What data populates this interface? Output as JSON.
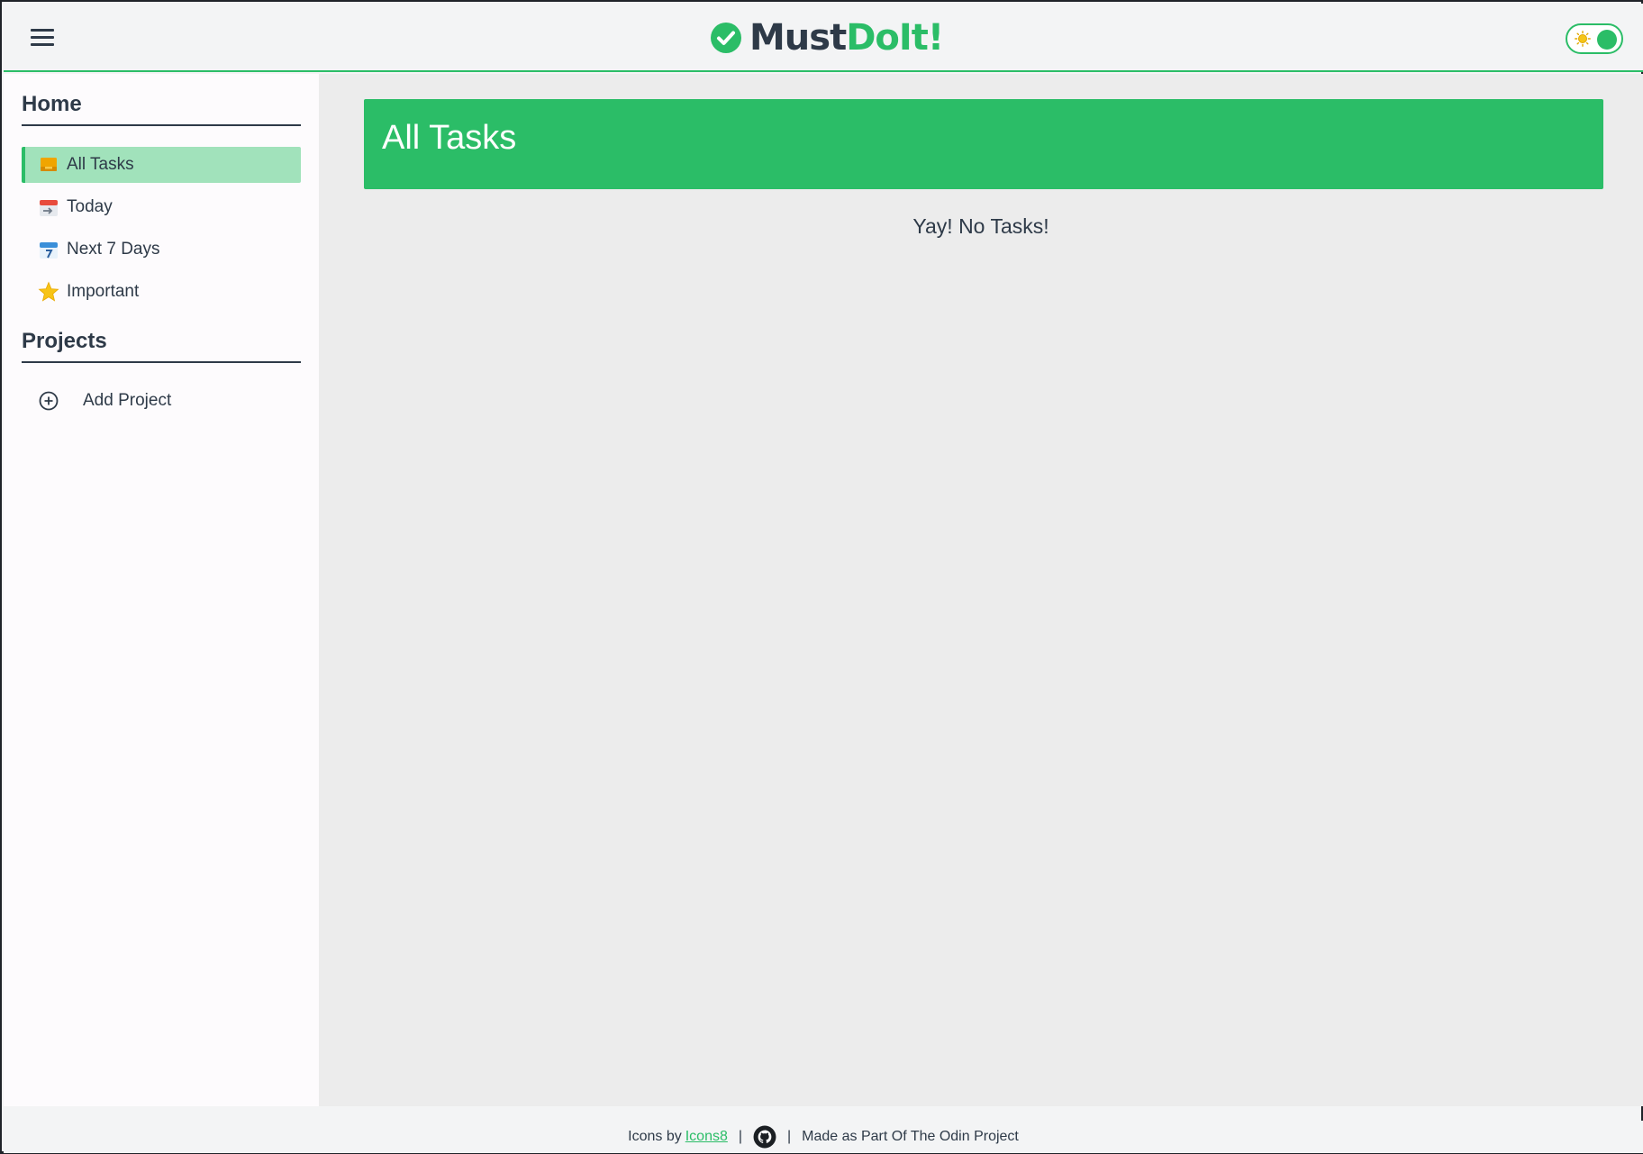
{
  "header": {
    "brand_part1": "Must",
    "brand_part2": "DoIt!",
    "menu_icon": "hamburger-icon",
    "theme_toggle_icon": "sun-icon"
  },
  "sidebar": {
    "home_title": "Home",
    "items": [
      {
        "label": "All Tasks",
        "icon": "inbox-icon",
        "active": true
      },
      {
        "label": "Today",
        "icon": "calendar-today-icon",
        "active": false
      },
      {
        "label": "Next 7 Days",
        "icon": "calendar-7-icon",
        "active": false
      },
      {
        "label": "Important",
        "icon": "star-icon",
        "active": false
      }
    ],
    "projects_title": "Projects",
    "add_project_label": "Add Project"
  },
  "main": {
    "title": "All Tasks",
    "empty_message": "Yay! No Tasks!"
  },
  "footer": {
    "icons_by": "Icons by",
    "icons_link": "Icons8",
    "sep": "|",
    "made_as": "Made as Part Of The Odin Project"
  },
  "colors": {
    "accent": "#2bbd67",
    "active_item_bg": "#a1e2bb",
    "text": "#2e3a48",
    "main_bg": "#ececec",
    "sidebar_bg": "#fdfbfd"
  }
}
